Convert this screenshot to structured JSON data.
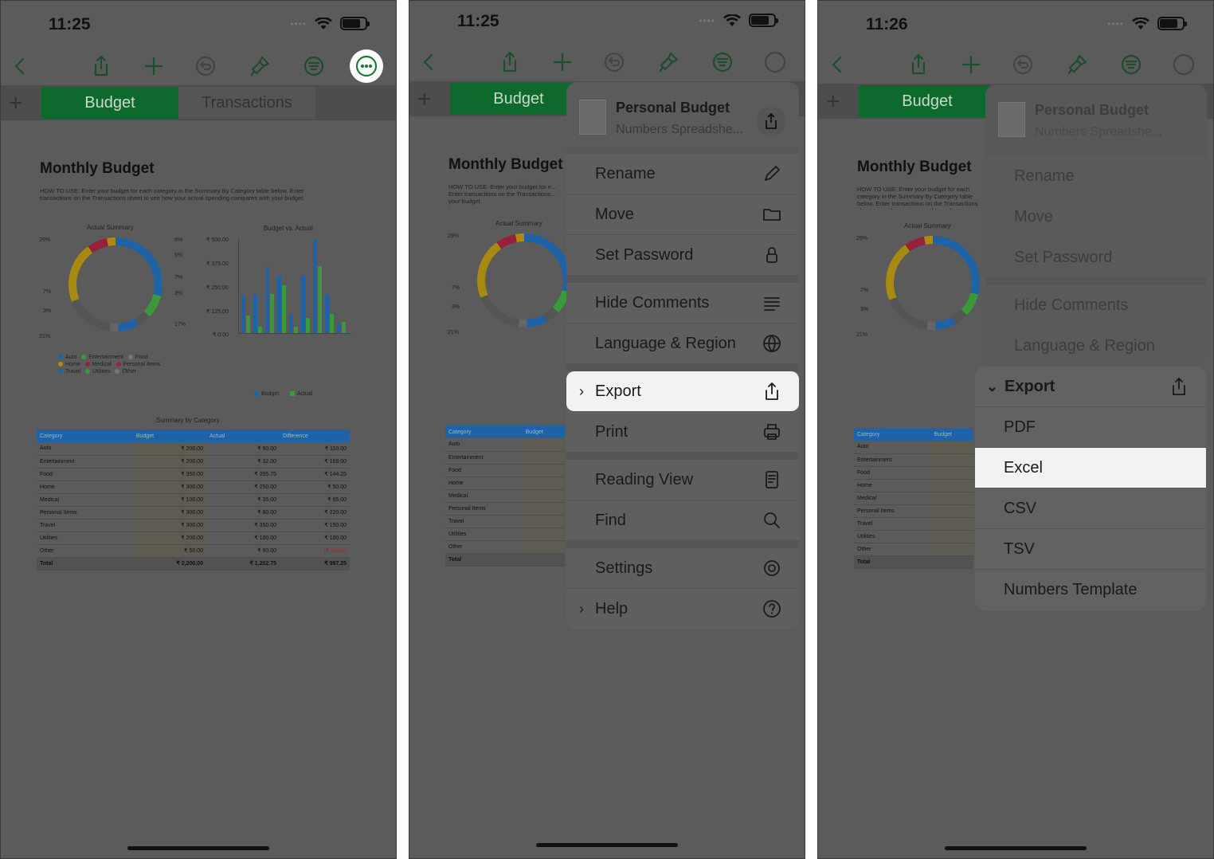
{
  "phones": [
    {
      "time": "11:25"
    },
    {
      "time": "11:25"
    },
    {
      "time": "11:26"
    }
  ],
  "tabs": {
    "budget": "Budget",
    "transactions": "Transactions"
  },
  "sheet": {
    "title": "Monthly Budget",
    "howto": "HOW TO USE: Enter your budget for each category in the Summary By Category table below. Enter transactions on the Transactions sheet to see how your actual spending compares with your budget.",
    "howto_short": "HOW TO USE: Enter your budget for e... Enter transactions on the Transactions... your budget.",
    "donut_title": "Actual Summary",
    "donut_labels": [
      "29%",
      "8%",
      "5%",
      "7%",
      "3%",
      "17%",
      "21%",
      "7%",
      "3%"
    ],
    "bar_title": "Budget vs. Actual",
    "bar_yticks": [
      "₹ 500.00",
      "₹ 375.00",
      "₹ 250.00",
      "₹ 125.00",
      "₹ 0.00"
    ],
    "bar_categories": [
      "Auto",
      "Entertainment",
      "Food",
      "Home",
      "Medical",
      "Personal Items",
      "Travel",
      "Utilities",
      "Other"
    ],
    "bar_legend": [
      "Budget",
      "Actual"
    ],
    "legend": [
      "Auto",
      "Entertainment",
      "Food",
      "Home",
      "Medical",
      "Personal Items",
      "Travel",
      "Utilities",
      "Other"
    ],
    "table_title": "Summary by Category",
    "table_headers": [
      "Category",
      "Budget",
      "Actual",
      "Difference"
    ],
    "rows": [
      [
        "Auto",
        "₹ 200.00",
        "₹ 90.00",
        "₹ 110.00"
      ],
      [
        "Entertainment",
        "₹ 200.00",
        "₹ 32.00",
        "₹ 168.00"
      ],
      [
        "Food",
        "₹ 350.00",
        "₹ 205.75",
        "₹ 144.25"
      ],
      [
        "Home",
        "₹ 300.00",
        "₹ 250.00",
        "₹ 50.00"
      ],
      [
        "Medical",
        "₹ 100.00",
        "₹ 35.00",
        "₹ 65.00"
      ],
      [
        "Personal Items",
        "₹ 300.00",
        "₹ 80.00",
        "₹ 220.00"
      ],
      [
        "Travel",
        "₹ 300.00",
        "₹ 350.00",
        "₹ 150.00"
      ],
      [
        "Utilities",
        "₹ 200.00",
        "₹ 100.00",
        "₹ 100.00"
      ],
      [
        "Other",
        "₹ 50.00",
        "₹ 60.00",
        "(₹ 10.00)"
      ]
    ],
    "total": [
      "Total",
      "₹ 2,200.00",
      "₹ 1,202.75",
      "₹ 997.25"
    ]
  },
  "menu": {
    "doc_title": "Personal Budget",
    "doc_sub": "Numbers Spreadshe...",
    "items": {
      "rename": "Rename",
      "move": "Move",
      "password": "Set Password",
      "comments": "Hide Comments",
      "language": "Language & Region",
      "export": "Export",
      "print": "Print",
      "reading": "Reading View",
      "find": "Find",
      "settings": "Settings",
      "help": "Help"
    },
    "export_options": [
      "PDF",
      "Excel",
      "CSV",
      "TSV",
      "Numbers Template"
    ]
  },
  "colors": {
    "accent": "#0d6a2c",
    "budget": "#1e62a8",
    "actual": "#3a9a3a"
  }
}
